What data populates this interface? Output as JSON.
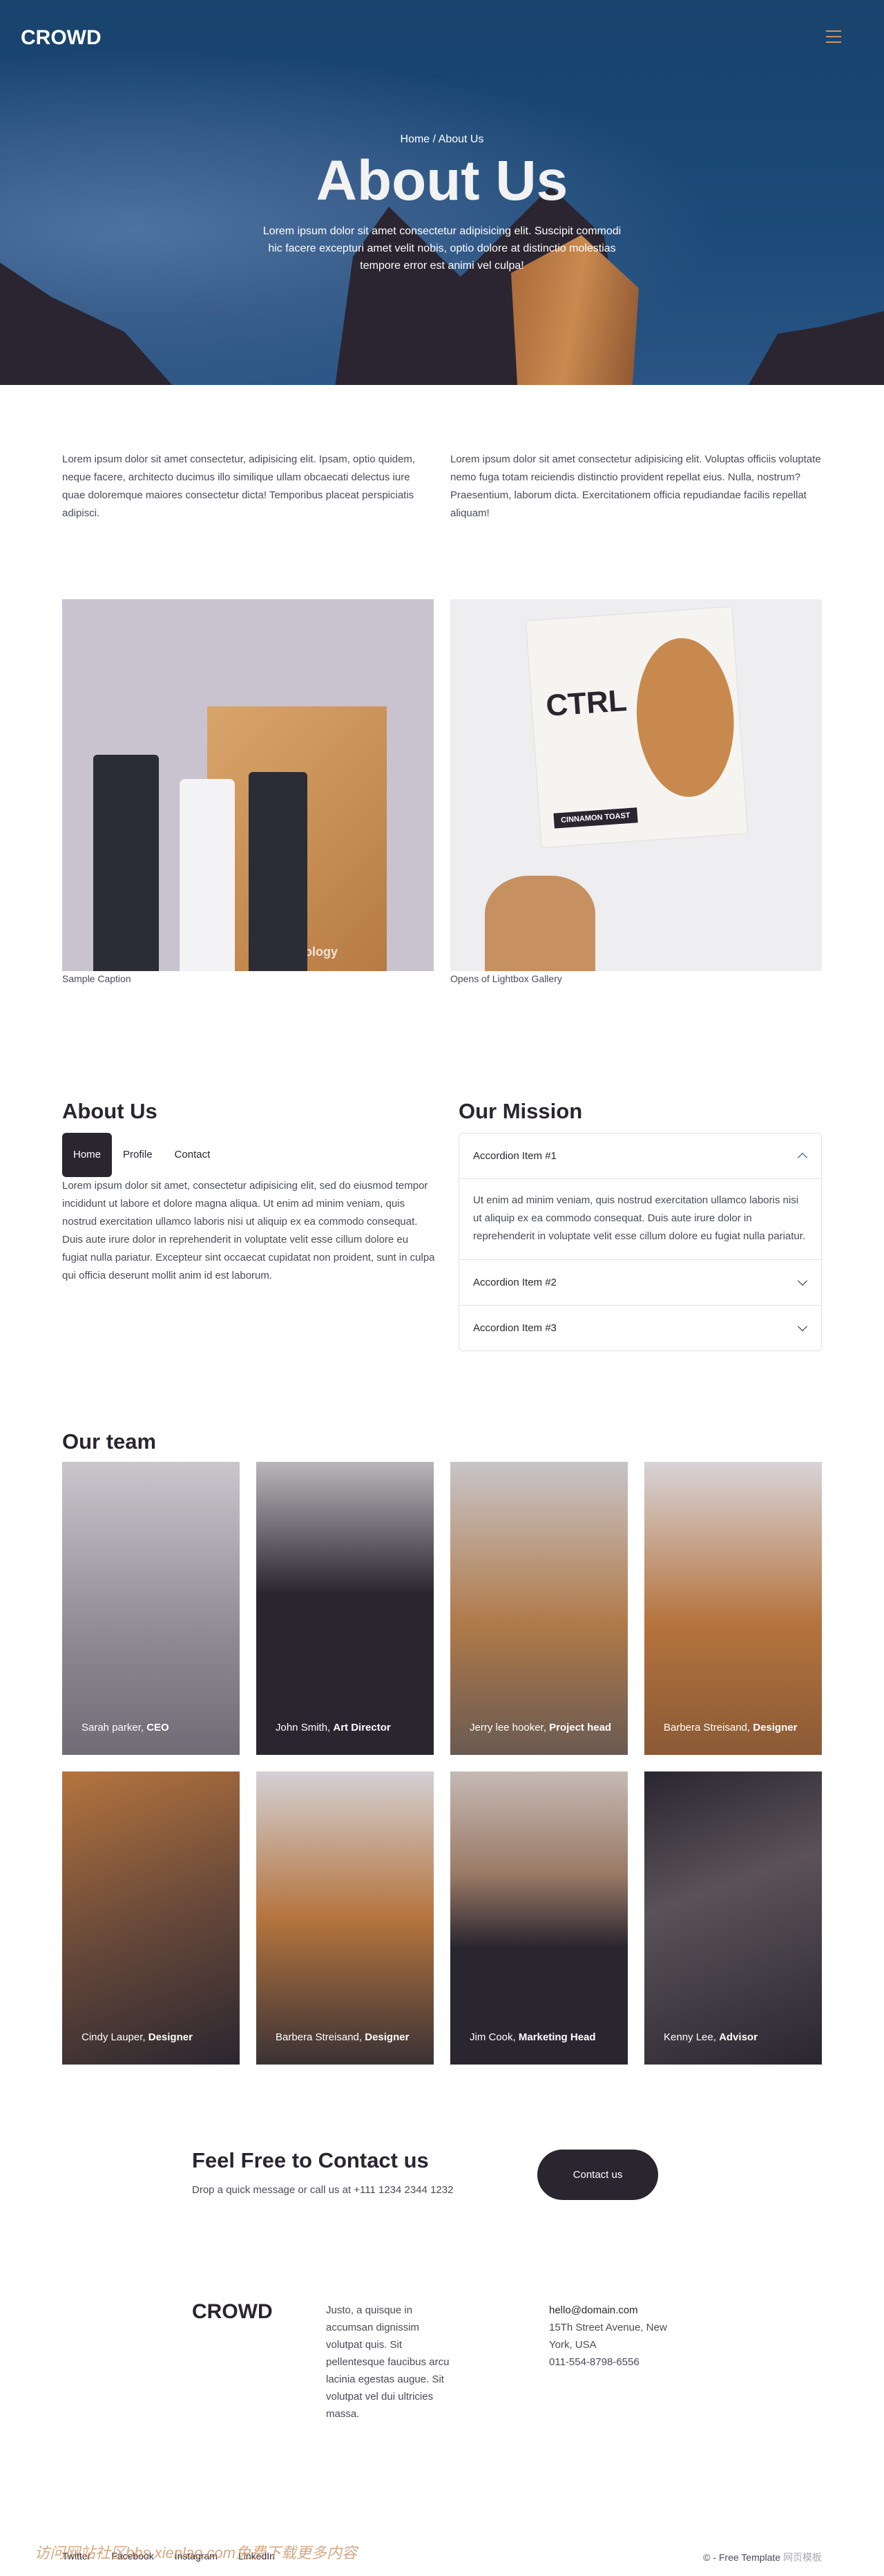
{
  "brand": "CROWD",
  "colors": {
    "accent": "#c8956b",
    "dark": "#2a2630",
    "hero_blue": "#1a4470"
  },
  "nav": {
    "menu_icon": "hamburger-icon"
  },
  "hero": {
    "breadcrumb_home": "Home",
    "breadcrumb_sep": " / ",
    "breadcrumb_current": "About Us",
    "title": "About Us",
    "text": "Lorem ipsum dolor sit amet consectetur adipisicing elit. Suscipit commodi hic facere excepturi amet velit nobis, optio dolore at distinctio molestias tempore error est animi vel culpa!"
  },
  "intro": [
    "Lorem ipsum dolor sit amet consectetur, adipisicing elit. Ipsam, optio quidem, neque facere, architecto ducimus illo similique ullam obcaecati delectus iure quae doloremque maiores consectetur dicta! Temporibus placeat perspiciatis adipisci.",
    "Lorem ipsum dolor sit amet consectetur adipisicing elit. Voluptas officiis voluptate nemo fuga totam reiciendis distinctio provident repellat eius. Nulla, nostrum? Praesentium, laborum dicta. Exercitationem officia repudiandae facilis repellat aliquam!"
  ],
  "gallery": [
    {
      "caption": "Sample Caption",
      "product": "Curology"
    },
    {
      "caption": "Opens of Lightbox Gallery",
      "product": "CTRL",
      "flavor": "CINNAMON TOAST"
    }
  ],
  "about": {
    "title": "About Us",
    "tabs": [
      "Home",
      "Profile",
      "Contact"
    ],
    "active_tab": "Home",
    "text": "Lorem ipsum dolor sit amet, consectetur adipisicing elit, sed do eiusmod tempor incididunt ut labore et dolore magna aliqua. Ut enim ad minim veniam, quis nostrud exercitation ullamco laboris nisi ut aliquip ex ea commodo consequat. Duis aute irure dolor in reprehenderit in voluptate velit esse cillum dolore eu fugiat nulla pariatur. Excepteur sint occaecat cupidatat non proident, sunt in culpa qui officia deserunt mollit anim id est laborum."
  },
  "mission": {
    "title": "Our Mission",
    "items": [
      {
        "label": "Accordion Item #1",
        "open": true,
        "body": "Ut enim ad minim veniam, quis nostrud exercitation ullamco laboris nisi ut aliquip ex ea commodo consequat. Duis aute irure dolor in reprehenderit in voluptate velit esse cillum dolore eu fugiat nulla pariatur."
      },
      {
        "label": "Accordion Item #2",
        "open": false
      },
      {
        "label": "Accordion Item #3",
        "open": false
      }
    ]
  },
  "team": {
    "title": "Our team",
    "members": [
      {
        "name": "Sarah parker, ",
        "role": "CEO"
      },
      {
        "name": "John Smith, ",
        "role": "Art Director"
      },
      {
        "name": "Jerry lee hooker, ",
        "role": "Project head"
      },
      {
        "name": "Barbera Streisand, ",
        "role": "Designer"
      },
      {
        "name": "Cindy Lauper, ",
        "role": "Designer"
      },
      {
        "name": "Barbera Streisand, ",
        "role": "Designer"
      },
      {
        "name": "Jim Cook, ",
        "role": "Marketing Head"
      },
      {
        "name": "Kenny Lee, ",
        "role": "Advisor"
      }
    ]
  },
  "contact": {
    "title": "Feel Free to Contact us",
    "text": "Drop a quick message or call us at +111 1234 2344 1232",
    "button": "Contact us"
  },
  "footer": {
    "logo": "CROWD",
    "text": "Justo, a quisque in accumsan dignissim volutpat quis. Sit pellentesque faucibus arcu lacinia egestas augue. Sit volutpat vel dui ultricies massa.",
    "email": "hello@domain.com",
    "address": "15Th Street Avenue, New York, USA",
    "phone": "011-554-8798-6556",
    "social": [
      "Twitter",
      "Facebook",
      "Instagram",
      "LinkedIn"
    ],
    "copyright": "© - Free Template ",
    "copyright_suffix": "网页模板",
    "watermark": "访问网站社区bbs.xienlao.com免费下载更多内容"
  }
}
